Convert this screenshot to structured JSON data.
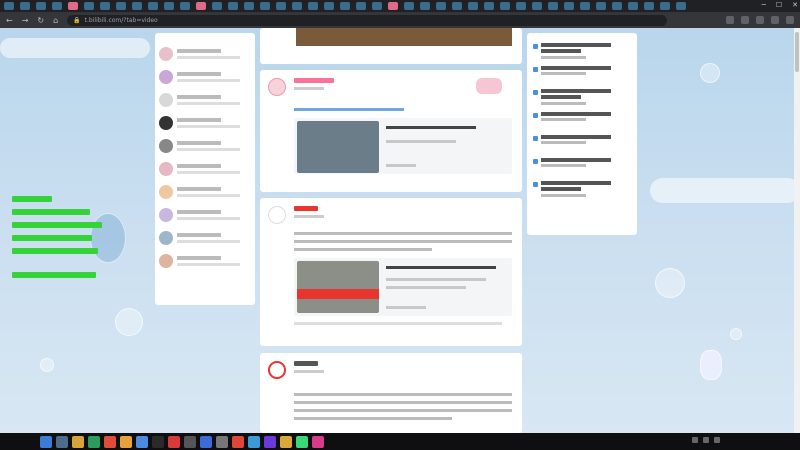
{
  "browser": {
    "url": "t.bilibili.com/?tab=video",
    "tab_count": 46
  },
  "live_panel": {
    "title": "",
    "count_label": "",
    "more_label": "",
    "item_count": 10
  },
  "feed": {
    "cards": [
      {
        "id": "card-partial",
        "stats": [
          "",
          "",
          ""
        ]
      },
      {
        "id": "card-baiyou",
        "avatar_color": "#f6d3d8",
        "stats": [
          "",
          "",
          ""
        ]
      },
      {
        "id": "card-cctv",
        "avatar_color": "#ffffff",
        "caption": "",
        "stats": [
          "",
          "",
          ""
        ]
      },
      {
        "id": "card-ign",
        "avatar_color": "#ffffff"
      }
    ]
  },
  "trending": {
    "title": "",
    "item_count": 7
  },
  "taskbar": {
    "watermark": "",
    "time": "",
    "date": ""
  },
  "colors": {
    "accent": "#fb7299",
    "link": "#6fa8dc",
    "overlay_text": "#35d23a",
    "background": "#c9def0"
  }
}
